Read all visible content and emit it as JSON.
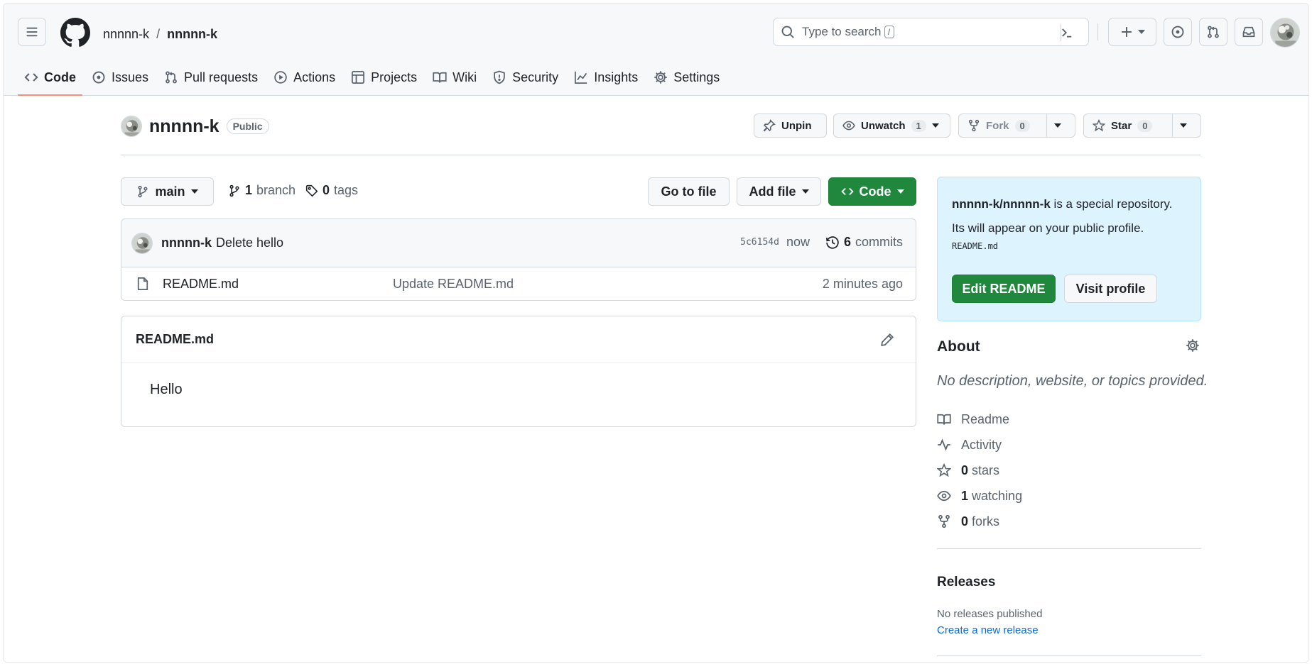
{
  "breadcrumb": {
    "owner": "nnnnn-k",
    "separator": "/",
    "repo": "nnnnn-k"
  },
  "search": {
    "placeholder": "Type to search",
    "shortcut": "/"
  },
  "tabs": [
    {
      "label": "Code",
      "icon": "code-icon",
      "active": true
    },
    {
      "label": "Issues",
      "icon": "issue-icon"
    },
    {
      "label": "Pull requests",
      "icon": "pull-request-icon"
    },
    {
      "label": "Actions",
      "icon": "play-icon"
    },
    {
      "label": "Projects",
      "icon": "table-icon"
    },
    {
      "label": "Wiki",
      "icon": "book-icon"
    },
    {
      "label": "Security",
      "icon": "shield-icon"
    },
    {
      "label": "Insights",
      "icon": "graph-icon"
    },
    {
      "label": "Settings",
      "icon": "gear-icon"
    }
  ],
  "repo": {
    "name": "nnnnn-k",
    "visibility": "Public"
  },
  "repo_actions": {
    "unpin": "Unpin",
    "unwatch": "Unwatch",
    "watch_count": "1",
    "fork": "Fork",
    "fork_count": "0",
    "star": "Star",
    "star_count": "0"
  },
  "file_nav": {
    "branch": "main",
    "branch_count": "1",
    "branch_label": "branch",
    "tag_count": "0",
    "tag_label": "tags",
    "goto_file": "Go to file",
    "add_file": "Add file",
    "code": "Code"
  },
  "latest_commit": {
    "author": "nnnnn-k",
    "message": "Delete hello",
    "sha": "5c6154d",
    "time": "now",
    "commit_count": "6",
    "commit_label": "commits"
  },
  "files": [
    {
      "name": "README.md",
      "message": "Update README.md",
      "time": "2 minutes ago"
    }
  ],
  "readme": {
    "filename": "README.md",
    "content": "Hello"
  },
  "special_repo": {
    "repo_path": "nnnnn-k/nnnnn-k",
    "line1_suffix": "is a special repository.",
    "line2": "Its will appear on your public profile.",
    "filename": "README.md",
    "edit_button": "Edit README",
    "visit_button": "Visit profile"
  },
  "about": {
    "title": "About",
    "description": "No description, website, or topics provided.",
    "readme": "Readme",
    "activity": "Activity",
    "stars_count": "0",
    "stars_label": "stars",
    "watching_count": "1",
    "watching_label": "watching",
    "forks_count": "0",
    "forks_label": "forks"
  },
  "releases": {
    "title": "Releases",
    "none": "No releases published",
    "create_link": "Create a new release"
  },
  "colors": {
    "primary_green": "#1f883d",
    "accent_underline": "#fd8c73",
    "link_blue": "#0969da",
    "special_bg": "#ddf4ff"
  }
}
